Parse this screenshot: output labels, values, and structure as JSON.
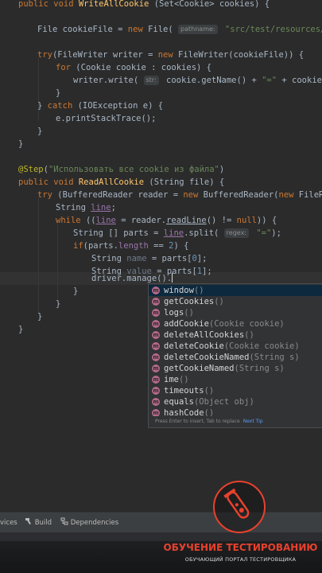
{
  "editor": {
    "l1_kw": "public void ",
    "l1_fn": "WriteAllCookie",
    "l1_rest": " (Set<Cookie> cookies) {",
    "l2_a": "File cookieFile = ",
    "l2_kw": "new ",
    "l2_b": "File( ",
    "l2_hint": "pathname:",
    "l2_str": " \"src/test/resources/cookie.t",
    "l3_kw": "try",
    "l3_a": "(FileWriter writer = ",
    "l3_kw2": "new ",
    "l3_b": "FileWriter(cookieFile)) {",
    "l4_kw": "for ",
    "l4_a": "(Cookie cookie : cookies) {",
    "l5_a": "writer.write( ",
    "l5_hint": "str:",
    "l5_b": " cookie.getName() + ",
    "l5_str": "\"=\"",
    "l5_c": " + cookie.getVal",
    "l6": "}",
    "l7_a": "} ",
    "l7_kw": "catch ",
    "l7_b": "(IOException e) {",
    "l8": "e.printStackTrace();",
    "l9": "}",
    "l10": "}",
    "l11_ann": "@Step",
    "l11_a": "(",
    "l11_str": "\"Использовать все cookie из файла\"",
    "l11_b": ")",
    "l12_kw": "public void ",
    "l12_fn": "ReadAllCookie ",
    "l12_a": "(String file) {",
    "l13_kw": "try ",
    "l13_a": "(BufferedReader reader = ",
    "l13_kw2": "new ",
    "l13_b": "BufferedReader(",
    "l13_kw3": "new ",
    "l13_c": "FileReader(",
    "l14_a": "String ",
    "l14_b": "line",
    "l14_c": ";",
    "l15_kw": "while ",
    "l15_a": "((",
    "l15_b": "line",
    "l15_c": " = reader.",
    "l15_d": "readLine",
    "l15_e": "() != ",
    "l15_kw2": "null",
    "l15_f": ")) {",
    "l16_a": "String [] parts = ",
    "l16_b": "line",
    "l16_c": ".split( ",
    "l16_hint": "regex:",
    "l16_str": " \"=\"",
    "l16_d": ");",
    "l17_kw": "if",
    "l17_a": "(parts.",
    "l17_fld": "length",
    "l17_b": " == ",
    "l17_num": "2",
    "l17_c": ") {",
    "l18_a": "String ",
    "l18_dim": "name",
    "l18_b": " = parts[",
    "l18_num": "0",
    "l18_c": "];",
    "l19_a": "String ",
    "l19_dim": "value",
    "l19_b": " = parts[",
    "l19_num": "1",
    "l19_c": "];",
    "l20": "driver.manage().",
    "l21": "}",
    "l22": "}",
    "l23": "}",
    "l24": "}"
  },
  "autocomplete": {
    "badge": "m",
    "items": [
      {
        "name": "window",
        "params": "()"
      },
      {
        "name": "getCookies",
        "params": "()"
      },
      {
        "name": "logs",
        "params": "()"
      },
      {
        "name": "addCookie",
        "params": "(Cookie cookie)"
      },
      {
        "name": "deleteAllCookies",
        "params": "()"
      },
      {
        "name": "deleteCookie",
        "params": "(Cookie cookie)"
      },
      {
        "name": "deleteCookieNamed",
        "params": "(String s)"
      },
      {
        "name": "getCookieNamed",
        "params": "(String s)"
      },
      {
        "name": "ime",
        "params": "()"
      },
      {
        "name": "timeouts",
        "params": "()"
      },
      {
        "name": "equals",
        "params": "(Object obj)"
      },
      {
        "name": "hashCode",
        "params": "()"
      }
    ],
    "footer_text": "Press Enter to insert, Tab to replace",
    "footer_tip": "Next Tip"
  },
  "bottom_bar": {
    "services": "vices",
    "build": "Build",
    "dependencies": "Dependencies"
  },
  "brand": {
    "title": "ОБУЧЕНИЕ ТЕСТИРОВАНИЮ",
    "subtitle": "ОБУЧАЮЩИЙ ПОРТАЛ ТЕСТИРОВЩИКА"
  },
  "colors": {
    "background": "#2b2b2b",
    "keyword": "#cc7832",
    "string": "#6a8759",
    "annotation": "#bbb529",
    "number": "#6897bb",
    "brand_red": "#e8412d"
  }
}
